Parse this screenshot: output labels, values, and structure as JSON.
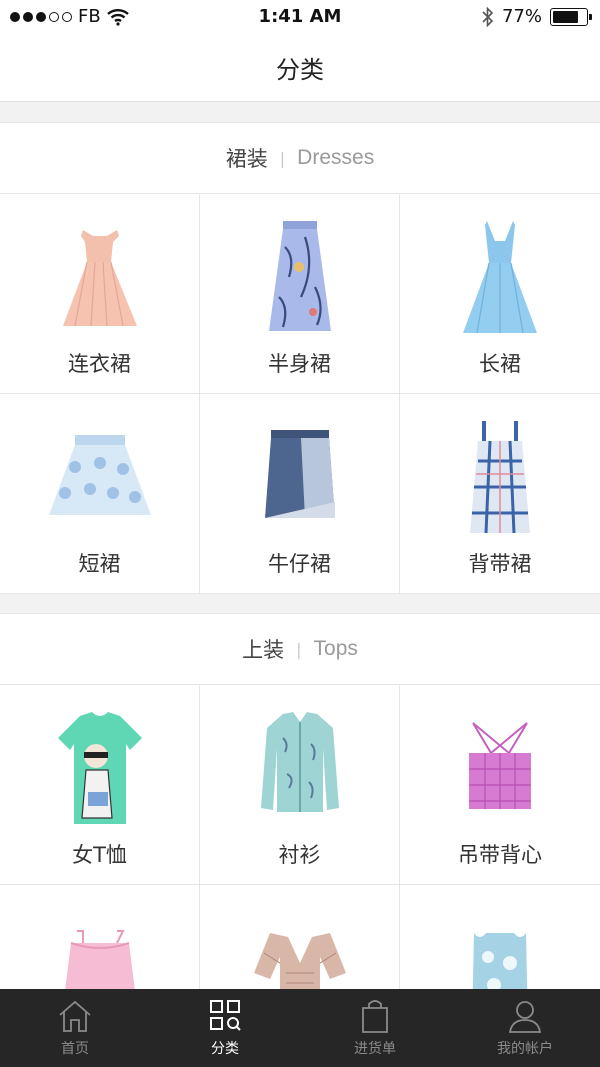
{
  "status_bar": {
    "carrier": "FB",
    "time": "1:41 AM",
    "battery": "77%",
    "battery_level": 0.77
  },
  "nav": {
    "title": "分类"
  },
  "sections": [
    {
      "title_zh": "裙装",
      "title_en": "Dresses",
      "items": [
        {
          "label": "连衣裙",
          "icon": "dress-icon"
        },
        {
          "label": "半身裙",
          "icon": "long-skirt-icon"
        },
        {
          "label": "长裙",
          "icon": "blue-dress-icon"
        },
        {
          "label": "短裙",
          "icon": "short-skirt-icon"
        },
        {
          "label": "牛仔裙",
          "icon": "denim-skirt-icon"
        },
        {
          "label": "背带裙",
          "icon": "pinafore-dress-icon"
        }
      ]
    },
    {
      "title_zh": "上装",
      "title_en": "Tops",
      "items": [
        {
          "label": "女T恤",
          "icon": "tshirt-icon"
        },
        {
          "label": "衬衫",
          "icon": "shirt-icon"
        },
        {
          "label": "吊带背心",
          "icon": "camisole-icon"
        },
        {
          "label": "",
          "icon": "pink-top-icon"
        },
        {
          "label": "",
          "icon": "knit-top-icon"
        },
        {
          "label": "",
          "icon": "lace-top-icon"
        }
      ]
    }
  ],
  "tab_bar": {
    "tabs": [
      {
        "label": "首页",
        "icon": "home-icon",
        "active": false
      },
      {
        "label": "分类",
        "icon": "category-grid-icon",
        "active": true
      },
      {
        "label": "进货单",
        "icon": "shopping-bag-icon",
        "active": false
      },
      {
        "label": "我的帐户",
        "icon": "user-icon",
        "active": false
      }
    ]
  }
}
